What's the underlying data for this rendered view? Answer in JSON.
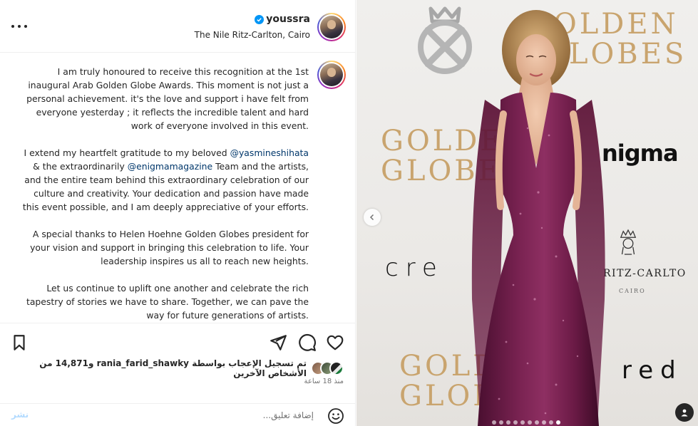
{
  "header": {
    "username": "youssra",
    "location": "The Nile Ritz-Carlton, Cairo"
  },
  "caption": {
    "username": "youssra",
    "p1": "I am truly honoured to receive this recognition at the 1st inaugural Arab Golden Globe Awards. This moment is not just a personal achievement. it's the love and support i have felt from everyone yesterday ; it reflects the incredible talent and hard work of everyone involved in this event.",
    "p2_a": "I extend my heartfelt gratitude to my beloved",
    "p2_mention1": "@yasmineshihata",
    "p2_b": "& the extraordinarily",
    "p2_mention2": "@enigmamagazine",
    "p2_c": "Team and the artists, and the entire team behind this extraordinary celebration of our culture and creativity. Your dedication and passion have made this event possible, and I am deeply appreciative of your efforts.",
    "p3": "A special thanks to Helen Hoehne Golden Globes president for your vision and support in bringing this celebration to life. Your leadership inspires us all to reach new heights.",
    "p4": "Let us continue to uplift one another and celebrate the rich tapestry of stories we have to share. Together, we can pave the way for future generations of artists."
  },
  "likes": {
    "text": "تم تسجيل الإعجاب بواسطة rania_farid_shawky و14,871 من الأشخاص الآخرين"
  },
  "time": "منذ 18 ساعة",
  "comment": {
    "placeholder": "إضافة تعليق...",
    "post_label": "نشر"
  },
  "photo": {
    "golden_top": "GOLDEN",
    "globes_top": "GLOBES",
    "golden_mid": "GOLDEN",
    "globes_mid": "GLOBE",
    "golden_bot": "GOLD",
    "globes_bot": "GLOBE",
    "enigma": "nigma",
    "cred": "cre",
    "cred2": "red",
    "ritz": "RITZ-CARLTO",
    "cairo": "CAIRO"
  },
  "carousel": {
    "count": 10,
    "active_index": 9
  },
  "colors": {
    "accent": "#0095f6",
    "gown": "#6b1a45",
    "gold": "#c9a46e"
  },
  "icons": [
    "more-icon",
    "verified-icon",
    "bookmark-icon",
    "share-icon",
    "comment-icon",
    "heart-icon",
    "emoji-icon",
    "chevron-left-icon",
    "user-tag-icon"
  ]
}
